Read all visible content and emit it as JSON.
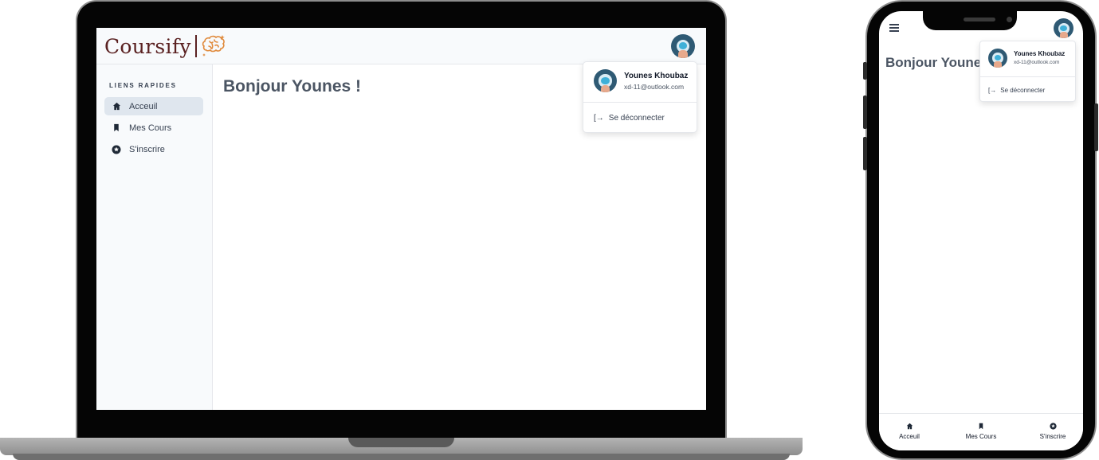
{
  "brand": {
    "name": "Coursify",
    "logo_icon": "brain-icon",
    "accent": "#5a2121",
    "logo_glyph_color": "#e08a3c"
  },
  "sidebar": {
    "title": "LIENS RAPIDES",
    "items": [
      {
        "label": "Acceuil",
        "icon": "home-icon",
        "active": true
      },
      {
        "label": "Mes Cours",
        "icon": "bookmark-icon",
        "active": false
      },
      {
        "label": "S'inscrire",
        "icon": "star-circle-icon",
        "active": false
      }
    ]
  },
  "main": {
    "greeting": "Bonjour Younes !"
  },
  "user_menu": {
    "name": "Younes Khoubaz",
    "email": "xd-11@outlook.com",
    "logout_label": "Se déconnecter",
    "logout_icon": "logout-icon"
  },
  "mobile": {
    "greeting": "Bonjour Younes !",
    "menu_icon": "hamburger-icon",
    "user_menu": {
      "name": "Younes Khoubaz",
      "email": "xd-11@outlook.com",
      "logout_label": "Se déconnecter"
    },
    "bottom_nav": [
      {
        "label": "Acceuil",
        "icon": "home-icon"
      },
      {
        "label": "Mes Cours",
        "icon": "bookmark-icon"
      },
      {
        "label": "S'inscrire",
        "icon": "star-circle-icon"
      }
    ]
  },
  "colors": {
    "sidebar_active_bg": "#dfe6ee",
    "heading": "#4b5563",
    "avatar_bg": "#2f5a74"
  }
}
